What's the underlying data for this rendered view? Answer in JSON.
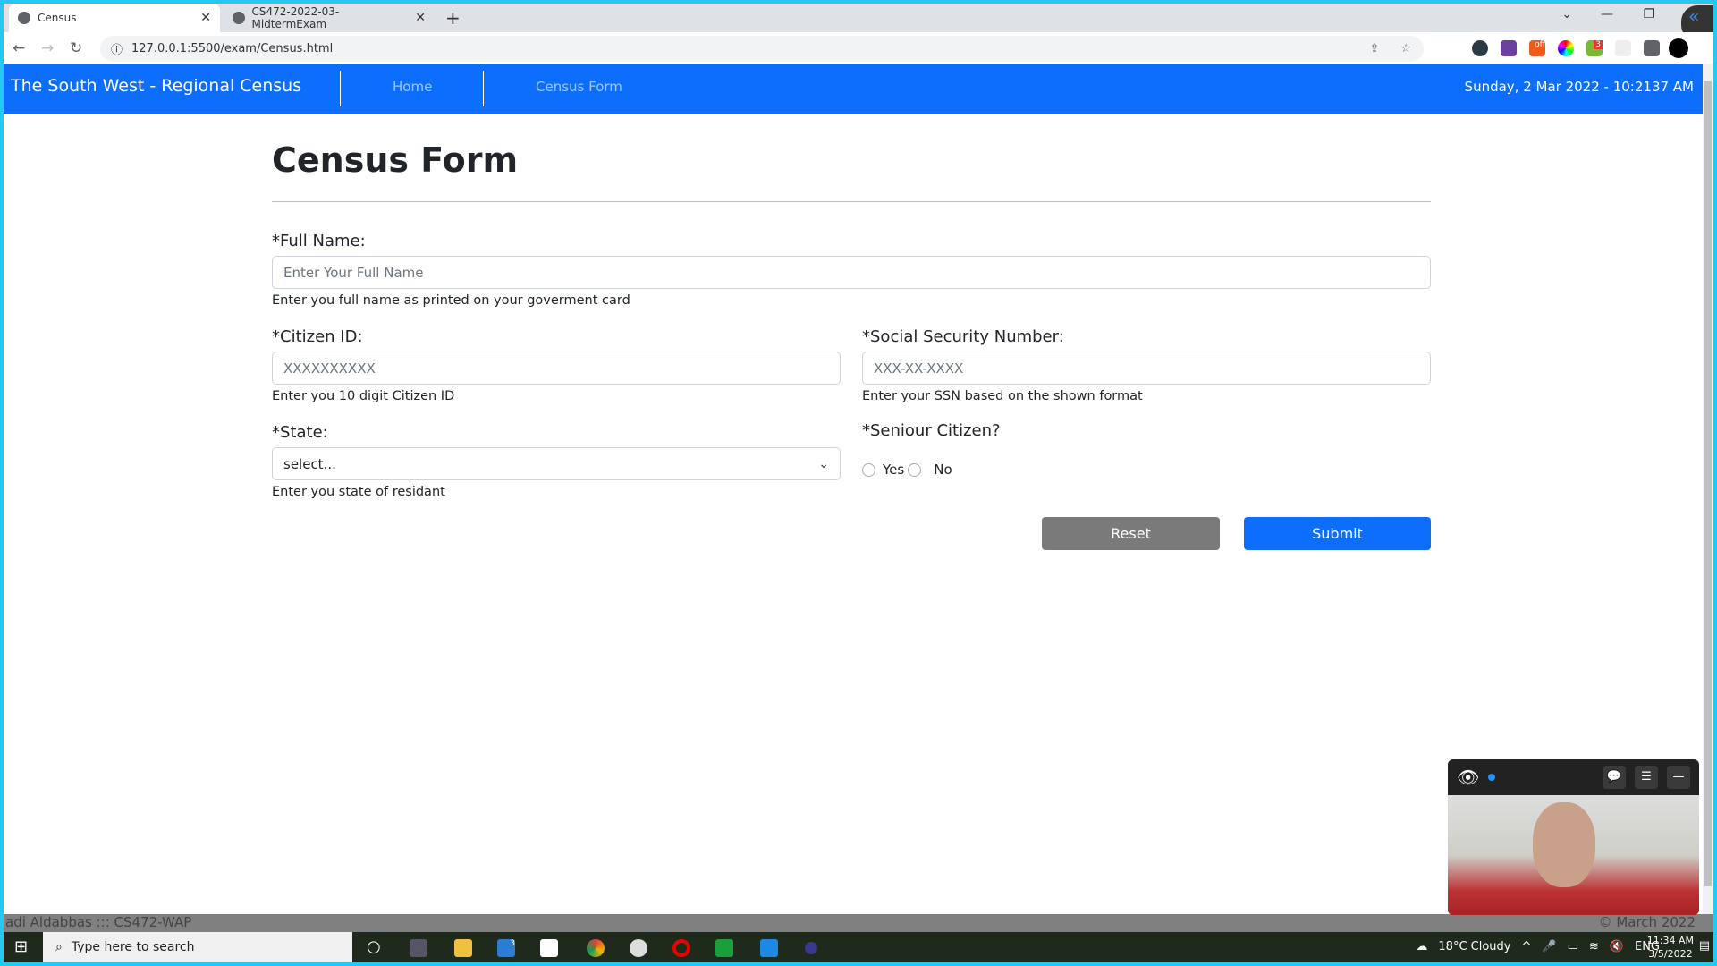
{
  "browser": {
    "tabs": [
      {
        "label": "Census",
        "active": true
      },
      {
        "label": "CS472-2022-03-MidtermExam",
        "active": false
      }
    ],
    "url": "127.0.0.1:5500/exam/Census.html",
    "extension_badges": [
      "off",
      "3"
    ]
  },
  "navbar": {
    "brand": "The South West - Regional Census",
    "links": [
      "Home",
      "Census Form"
    ],
    "datetime": "Sunday, 2 Mar 2022 - 10:2137 AM",
    "color": "#0d6efd"
  },
  "form": {
    "title": "Census Form",
    "full_name": {
      "label": "*Full Name:",
      "placeholder": "Enter Your Full Name",
      "help": "Enter you full name as printed on your goverment card"
    },
    "citizen_id": {
      "label": "*Citizen ID:",
      "placeholder": "XXXXXXXXXX",
      "help": "Enter you 10 digit Citizen ID"
    },
    "ssn": {
      "label": "*Social Security Number:",
      "placeholder": "XXX-XX-XXXX",
      "help": "Enter your SSN based on the shown format"
    },
    "state": {
      "label": "*State:",
      "selected": "select...",
      "help": "Enter you state of residant"
    },
    "senior": {
      "label": "*Seniour Citizen?",
      "options": [
        "Yes",
        "No"
      ]
    },
    "reset_label": "Reset",
    "submit_label": "Submit"
  },
  "footer": {
    "left": "adi Aldabbas ::: CS472-WAP",
    "right": "© March 2022"
  },
  "taskbar": {
    "search_placeholder": "Type here to search",
    "weather": "18°C  Cloudy",
    "lang": "ENG",
    "time": "11:34 AM",
    "date": "3/5/2022",
    "mail_badge": "3"
  }
}
